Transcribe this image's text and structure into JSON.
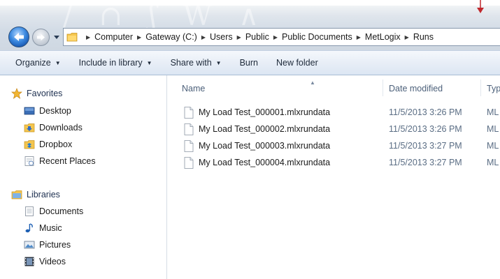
{
  "window": {
    "accent": "#cfd8e2",
    "annotation_color": "#c0282d"
  },
  "navigation": {
    "back_icon": "back-arrow-icon",
    "forward_icon": "forward-arrow-icon"
  },
  "address_bar": {
    "folder_icon": "folder-icon",
    "breadcrumbs": [
      "Computer",
      "Gateway (C:)",
      "Users",
      "Public",
      "Public Documents",
      "MetLogix",
      "Runs"
    ]
  },
  "toolbar": {
    "organize": "Organize",
    "include_in_library": "Include in library",
    "share_with": "Share with",
    "burn": "Burn",
    "new_folder": "New folder"
  },
  "sidebar": {
    "favorites_label": "Favorites",
    "favorites": [
      {
        "label": "Desktop",
        "icon": "desktop-icon"
      },
      {
        "label": "Downloads",
        "icon": "downloads-icon"
      },
      {
        "label": "Dropbox",
        "icon": "dropbox-icon"
      },
      {
        "label": "Recent Places",
        "icon": "recent-places-icon"
      }
    ],
    "libraries_label": "Libraries",
    "libraries": [
      {
        "label": "Documents",
        "icon": "documents-icon"
      },
      {
        "label": "Music",
        "icon": "music-icon"
      },
      {
        "label": "Pictures",
        "icon": "pictures-icon"
      },
      {
        "label": "Videos",
        "icon": "videos-icon"
      }
    ]
  },
  "file_list": {
    "columns": {
      "name": "Name",
      "date_modified": "Date modified",
      "type": "Typ"
    },
    "files": [
      {
        "name": "My Load Test_000001.mlxrundata",
        "date": "11/5/2013 3:26 PM",
        "type": "ML"
      },
      {
        "name": "My Load Test_000002.mlxrundata",
        "date": "11/5/2013 3:26 PM",
        "type": "ML"
      },
      {
        "name": "My Load Test_000003.mlxrundata",
        "date": "11/5/2013 3:27 PM",
        "type": "ML"
      },
      {
        "name": "My Load Test_000004.mlxrundata",
        "date": "11/5/2013 3:27 PM",
        "type": "ML"
      }
    ]
  }
}
